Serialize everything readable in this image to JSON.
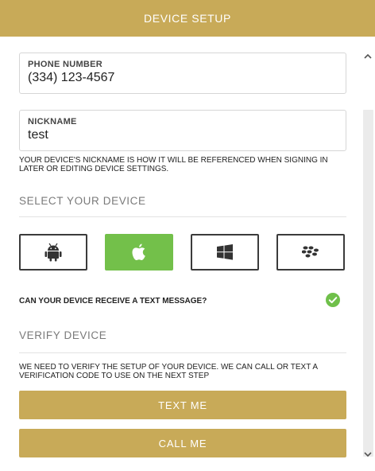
{
  "header": {
    "title": "DEVICE SETUP"
  },
  "colors": {
    "accent": "#c8aa58",
    "selected": "#73c04a",
    "check": "#6fc04a"
  },
  "phone": {
    "label": "PHONE NUMBER",
    "value": "(334) 123-4567"
  },
  "nickname": {
    "label": "NICKNAME",
    "value": "test",
    "help": "YOUR DEVICE'S NICKNAME IS HOW IT WILL BE REFERENCED WHEN SIGNING IN LATER OR EDITING DEVICE SETTINGS."
  },
  "select_device": {
    "title": "SELECT YOUR DEVICE",
    "options": [
      {
        "icon": "android-icon",
        "selected": false
      },
      {
        "icon": "apple-icon",
        "selected": true
      },
      {
        "icon": "windows-icon",
        "selected": false
      },
      {
        "icon": "blackberry-icon",
        "selected": false
      }
    ],
    "text_question": "CAN YOUR DEVICE RECEIVE A TEXT MESSAGE?",
    "text_capable": true
  },
  "verify": {
    "title": "VERIFY DEVICE",
    "help": "WE NEED TO VERIFY THE SETUP OF YOUR DEVICE. WE CAN CALL OR TEXT A VERIFICATION CODE TO USE ON THE NEXT STEP",
    "text_button": "TEXT ME",
    "call_button": "CALL ME"
  }
}
